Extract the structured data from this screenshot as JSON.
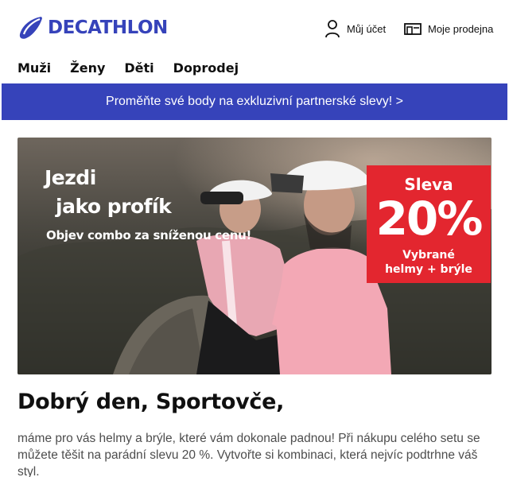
{
  "brand": {
    "name": "DECATHLON",
    "color": "#3643ba"
  },
  "header": {
    "account_label": "Můj účet",
    "account_icon": "user-icon",
    "store_label": "Moje prodejna",
    "store_icon": "store-icon"
  },
  "nav": {
    "items": [
      "Muži",
      "Ženy",
      "Děti",
      "Doprodej"
    ]
  },
  "promo_bar": {
    "text": "Proměňte své body na exkluzivní partnerské slevy! >",
    "color": "#3643ba"
  },
  "hero": {
    "line1": "Jezdi",
    "line2": "jako profík",
    "line3": "Objev combo za sníženou cenu!",
    "badge": {
      "label": "Sleva",
      "value": "20%",
      "desc_line1": "Vybrané",
      "desc_line2": "helmy + brýle",
      "color": "#e3262f"
    }
  },
  "content": {
    "greeting": "Dobrý den, Sportovče,",
    "paragraph": "máme pro vás helmy a brýle, které vám dokonale padnou! Při nákupu celého setu se můžete těšit na parádní slevu 20 %. Vytvořte si kombinaci, která nejvíc podtrhne váš styl."
  }
}
